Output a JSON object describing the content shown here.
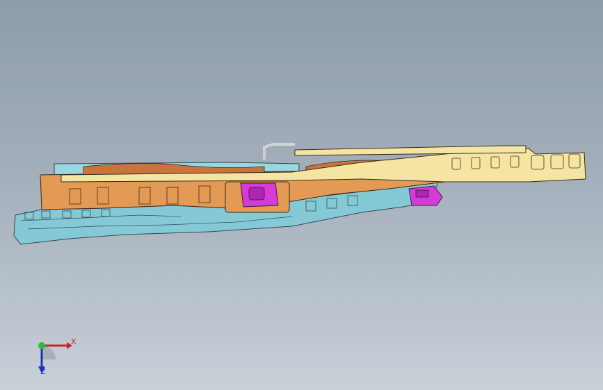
{
  "viewport": {
    "background_top": "#8e9cab",
    "background_bottom": "#c8d0d8"
  },
  "model": {
    "colors": {
      "orange_body": "#e39a55",
      "yellow_plate": "#f4e6a2",
      "blue_frame": "#86c9d6",
      "magenta_part": "#d63ad8",
      "edge_line": "#3a2a1a"
    }
  },
  "triad": {
    "x_label": "X",
    "z_label": "Z",
    "x_color": "#d02020",
    "z_color": "#1e2fb8",
    "origin_color": "#22c040"
  }
}
